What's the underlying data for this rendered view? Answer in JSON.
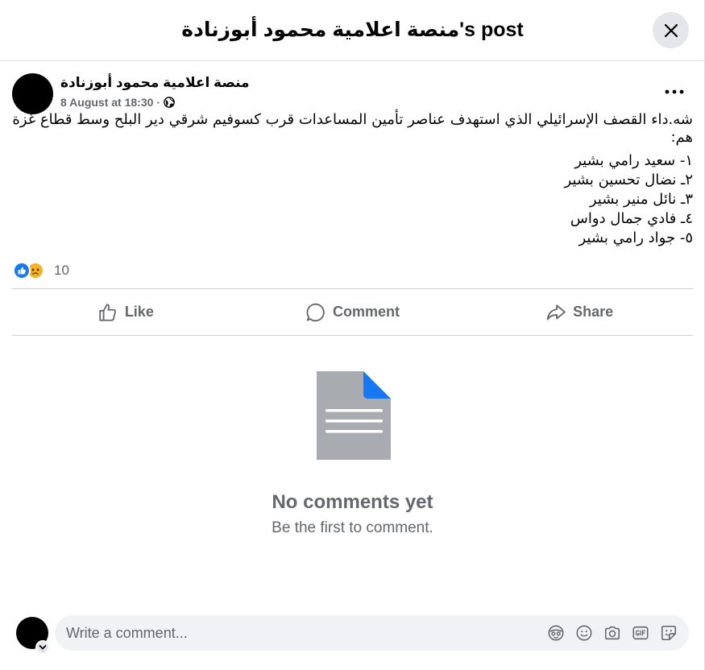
{
  "header": {
    "title": "منصة اعلامية محمود أبوزنادة's post"
  },
  "post": {
    "author": "منصة اعلامية محمود أبوزنادة",
    "date": "8 August at 18:30",
    "separator": "·",
    "audience_icon": "globe-icon",
    "text_lines": [
      "شه.داء القصف الإسرائيلي الذي استهدف عناصر تأمين المساعدات قرب كسوفيم شرقي دير البلح وسط قطاع غزة",
      "هم:"
    ],
    "list_items": [
      "١- سعيد رامي بشير",
      "٢ـ نضال تحسين بشير",
      "٣ـ نائل منير بشير",
      "٤ـ فادي جمال دواس",
      "٥- جواد رامي بشير"
    ]
  },
  "reactions": {
    "count": "10",
    "icons": [
      "like-icon",
      "sad-icon"
    ]
  },
  "actions": {
    "like": "Like",
    "comment": "Comment",
    "share": "Share"
  },
  "empty_state": {
    "title": "No comments yet",
    "subtitle": "Be the first to comment."
  },
  "composer": {
    "placeholder": "Write a comment...",
    "tools": [
      "avatar-sticker-icon",
      "emoji-icon",
      "camera-icon",
      "gif-icon",
      "sticker-icon"
    ]
  },
  "colors": {
    "accent": "#1877f2",
    "secondary_text": "#65676b",
    "doc_gray": "#a8abaf",
    "sad_yellow": "#f7b125"
  }
}
